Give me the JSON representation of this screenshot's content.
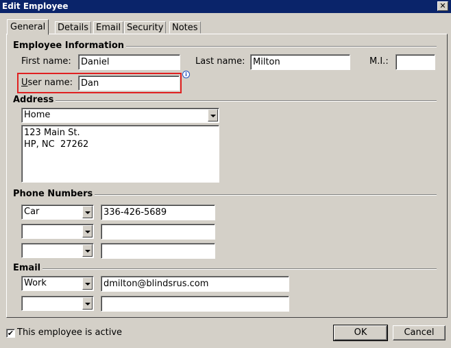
{
  "window": {
    "title": "Edit Employee",
    "close_glyph": "✕"
  },
  "tabs": [
    "General",
    "Details",
    "Email",
    "Security",
    "Notes"
  ],
  "employee_info": {
    "heading": "Employee Information",
    "first_name_label": "First name:",
    "first_name_value": "Daniel",
    "last_name_label": "Last name:",
    "last_name_value": "Milton",
    "mi_label": "M.I.:",
    "mi_value": "",
    "user_name_label_first": "U",
    "user_name_label_rest": "ser name:",
    "user_name_value": "Dan",
    "info_icon_glyph": "i"
  },
  "address": {
    "heading": "Address",
    "type_selected": "Home",
    "text": "123 Main St.\nHP, NC  27262"
  },
  "phones": {
    "heading": "Phone Numbers",
    "rows": [
      {
        "type": "Car",
        "number": "336-426-5689"
      },
      {
        "type": "",
        "number": ""
      },
      {
        "type": "",
        "number": ""
      }
    ]
  },
  "email": {
    "heading": "Email",
    "rows": [
      {
        "type": "Work",
        "address": "dmilton@blindsrus.com"
      },
      {
        "type": "",
        "address": ""
      }
    ]
  },
  "active": {
    "label": "This employee is active",
    "checked": true,
    "check_glyph": "✔"
  },
  "buttons": {
    "ok": "OK",
    "cancel": "Cancel"
  },
  "colors": {
    "title_bar": "#0a246a",
    "dialog_bg": "#d4d0c8",
    "highlight": "#e02020"
  }
}
